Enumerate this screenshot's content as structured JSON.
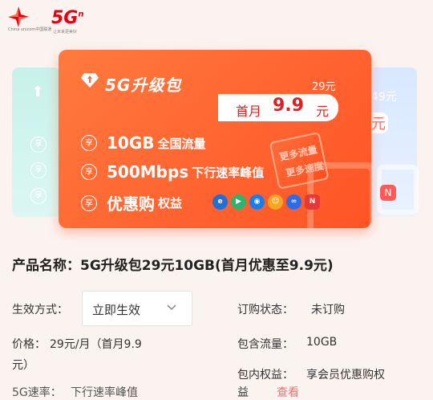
{
  "header": {
    "brand_cn": "China unicom中国联通",
    "brand_5g": "5G",
    "brand_sup": "n",
    "brand_sub": "让未来更美好"
  },
  "cards": {
    "left": {
      "lines": [
        "享",
        "享",
        "享"
      ]
    },
    "right": {
      "price": "49元",
      "price_first": "元"
    }
  },
  "main_card": {
    "title": "5G升级包",
    "original_price": "29元",
    "first_month_prefix": "首月",
    "first_month_price": "9.9",
    "first_month_unit": "元",
    "features": [
      {
        "icon": "享",
        "big": "10GB",
        "small": "全国流量"
      },
      {
        "icon": "享",
        "big": "500Mbps",
        "small": "下行速率峰值"
      },
      {
        "icon": "享",
        "big": "优惠购",
        "small": "权益"
      }
    ],
    "apps": [
      {
        "name": "e-icon",
        "letter": "e",
        "color": "#1e6fd9"
      },
      {
        "name": "play-icon",
        "letter": "▶",
        "color": "#2fb36f"
      },
      {
        "name": "eye-icon",
        "letter": "◉",
        "color": "#1a7ee6"
      },
      {
        "name": "smile-icon",
        "letter": "☺",
        "color": "#f5a623"
      },
      {
        "name": "cloud-icon",
        "letter": "∞",
        "color": "#2e6be6"
      },
      {
        "name": "netease-icon",
        "letter": "N",
        "color": "#e53935"
      }
    ],
    "deco": [
      "更多流量",
      "更多速度"
    ]
  },
  "details": {
    "product_name": "产品名称：5G升级包29元10GB(首月优惠至9.9元)",
    "effect_label": "生效方式：",
    "effect_value": "立即生效",
    "order_label": "订购状态：",
    "order_value": "未订购",
    "price_label": "价格：",
    "price_value_line1": "29元/月（首月9.9",
    "price_value_line2": "元）",
    "flow_label": "包含流量：",
    "flow_value": "10GB",
    "rights_label": "包内权益：",
    "rights_value": "享会员优惠购权",
    "cut_left": "5G速率：",
    "cut_left_value": "下行速率峰值",
    "cut_right": "益",
    "cut_right2": "查看"
  }
}
